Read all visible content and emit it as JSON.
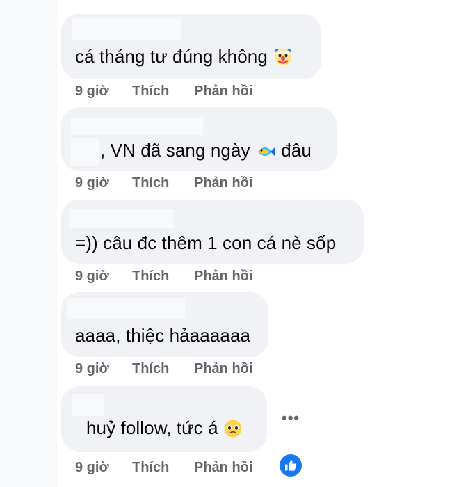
{
  "comments": [
    {
      "text": "cá tháng tư đúng không",
      "emoji_icon": "clown-face-icon",
      "time": "9 giờ",
      "like": "Thích",
      "reply": "Phản hồi"
    },
    {
      "text_before": ", VN đã sang ngày",
      "emoji_icon": "fish-icon",
      "text_after": "đâu",
      "time": "9 giờ",
      "like": "Thích",
      "reply": "Phản hồi"
    },
    {
      "text": "=)) câu đc thêm 1 con cá nè sốp",
      "time": "9 giờ",
      "like": "Thích",
      "reply": "Phản hồi"
    },
    {
      "text": "aaaa, thiệc hảaaaaaa",
      "time": "9 giờ",
      "like": "Thích",
      "reply": "Phản hồi"
    },
    {
      "text": "huỷ follow, tức á",
      "emoji_icon": "pleading-face-icon",
      "time": "9 giờ",
      "like": "Thích",
      "reply": "Phản hồi",
      "more": "•••",
      "reaction_icon": "thumbs-up-icon"
    }
  ],
  "colors": {
    "bubble": "#f0f2f5",
    "meta": "#65676b",
    "text": "#050505",
    "like_blue": "#1877f2"
  }
}
